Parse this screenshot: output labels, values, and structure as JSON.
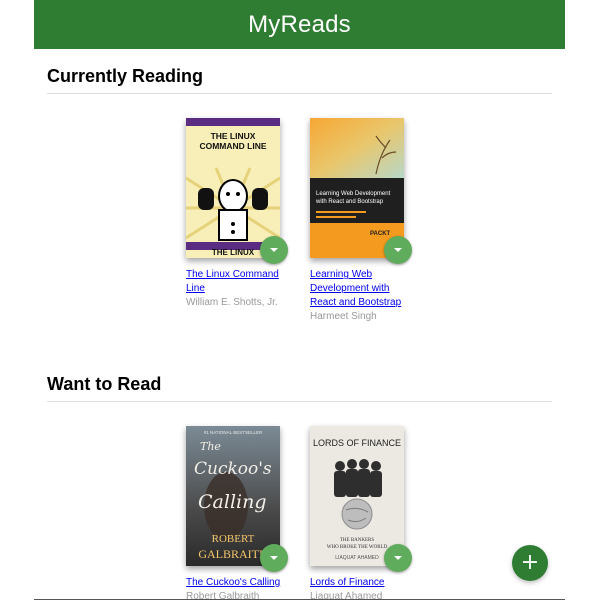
{
  "app": {
    "title": "MyReads"
  },
  "shelves": [
    {
      "title": "Currently Reading",
      "books": [
        {
          "title": "The Linux Command Line",
          "author": "William E. Shotts, Jr.",
          "cover_text": [
            "THE LINUX",
            "COMMAND LINE",
            "THE LINUX"
          ]
        },
        {
          "title": "Learning Web Development with React and Bootstrap",
          "author": "Harmeet Singh",
          "cover_text": [
            "Learning Web Development",
            "with React and Bootstrap",
            "PACKT"
          ]
        }
      ]
    },
    {
      "title": "Want to Read",
      "books": [
        {
          "title": "The Cuckoo's Calling",
          "author": "Robert Galbraith",
          "cover_text": [
            "#1 NATIONAL BESTSELLER",
            "The",
            "Cuckoo's",
            "Calling",
            "ROBERT",
            "GALBRAITH"
          ]
        },
        {
          "title": "Lords of Finance",
          "author": "Liaquat Ahamed",
          "cover_text": [
            "LORDS OF FINANCE",
            "THE BANKERS",
            "WHO BROKE THE WORLD",
            "LIAQUAT AHAMED"
          ]
        }
      ]
    }
  ],
  "add_button": {
    "label": "+"
  },
  "colors": {
    "header": "#2e7d32",
    "shelf_changer": "#60ac5d",
    "author": "#999999",
    "link": "#0000ee"
  }
}
